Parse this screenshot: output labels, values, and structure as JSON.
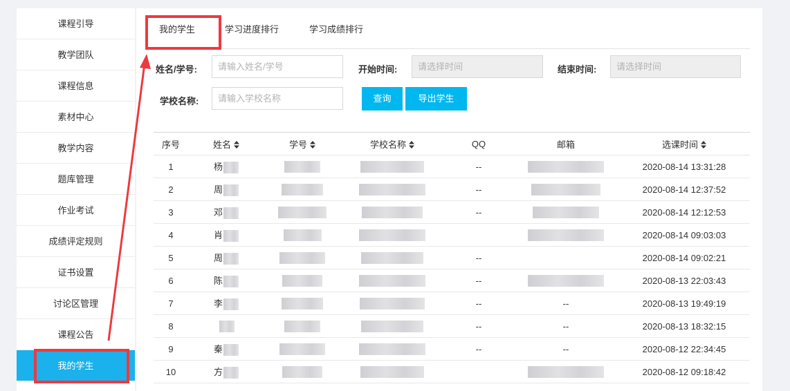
{
  "sidebar": {
    "items": [
      {
        "label": "课程引导",
        "active": false
      },
      {
        "label": "教学团队",
        "active": false
      },
      {
        "label": "课程信息",
        "active": false
      },
      {
        "label": "素材中心",
        "active": false
      },
      {
        "label": "教学内容",
        "active": false
      },
      {
        "label": "题库管理",
        "active": false
      },
      {
        "label": "作业考试",
        "active": false
      },
      {
        "label": "成绩评定规则",
        "active": false
      },
      {
        "label": "证书设置",
        "active": false
      },
      {
        "label": "讨论区管理",
        "active": false
      },
      {
        "label": "课程公告",
        "active": false
      },
      {
        "label": "我的学生",
        "active": true
      }
    ]
  },
  "tabs": [
    {
      "label": "我的学生",
      "active": true
    },
    {
      "label": "学习进度排行",
      "active": false
    },
    {
      "label": "学习成绩排行",
      "active": false
    }
  ],
  "filters": {
    "name_label": "姓名/学号:",
    "name_placeholder": "请输入姓名/学号",
    "start_label": "开始时间:",
    "start_placeholder": "请选择时间",
    "end_label": "结束时间:",
    "end_placeholder": "请选择时间",
    "school_label": "学校名称:",
    "school_placeholder": "请输入学校名称",
    "query_button": "查询",
    "export_button": "导出学生"
  },
  "table": {
    "headers": [
      "序号",
      "姓名",
      "学号",
      "学校名称",
      "QQ",
      "邮箱",
      "选课时间"
    ],
    "rows": [
      {
        "no": "1",
        "name": "杨",
        "qq": "--",
        "email": "",
        "time": "2020-08-14 13:31:28"
      },
      {
        "no": "2",
        "name": "周",
        "qq": "--",
        "email": "",
        "time": "2020-08-14 12:37:52"
      },
      {
        "no": "3",
        "name": "邓",
        "qq": "--",
        "email": "",
        "time": "2020-08-14 12:12:53"
      },
      {
        "no": "4",
        "name": "肖",
        "qq": "",
        "email": "",
        "time": "2020-08-14 09:03:03"
      },
      {
        "no": "5",
        "name": "周",
        "qq": "--",
        "email": "",
        "time": "2020-08-14 09:02:21"
      },
      {
        "no": "6",
        "name": "陈",
        "qq": "--",
        "email": "",
        "time": "2020-08-13 22:03:43"
      },
      {
        "no": "7",
        "name": "李",
        "qq": "--",
        "email": "--",
        "time": "2020-08-13 19:49:19"
      },
      {
        "no": "8",
        "name": "",
        "qq": "--",
        "email": "--",
        "time": "2020-08-13 18:32:15"
      },
      {
        "no": "9",
        "name": "秦",
        "qq": "--",
        "email": "--",
        "time": "2020-08-12 22:34:45"
      },
      {
        "no": "10",
        "name": "方",
        "qq": "",
        "email": "",
        "time": "2020-08-12 09:18:42"
      }
    ]
  },
  "colors": {
    "accent": "#00b7f0",
    "annotation_red": "#ed3a3f"
  },
  "icons": {
    "sort": "sort-caret-icon",
    "arrow": "red-annotation-arrow"
  }
}
